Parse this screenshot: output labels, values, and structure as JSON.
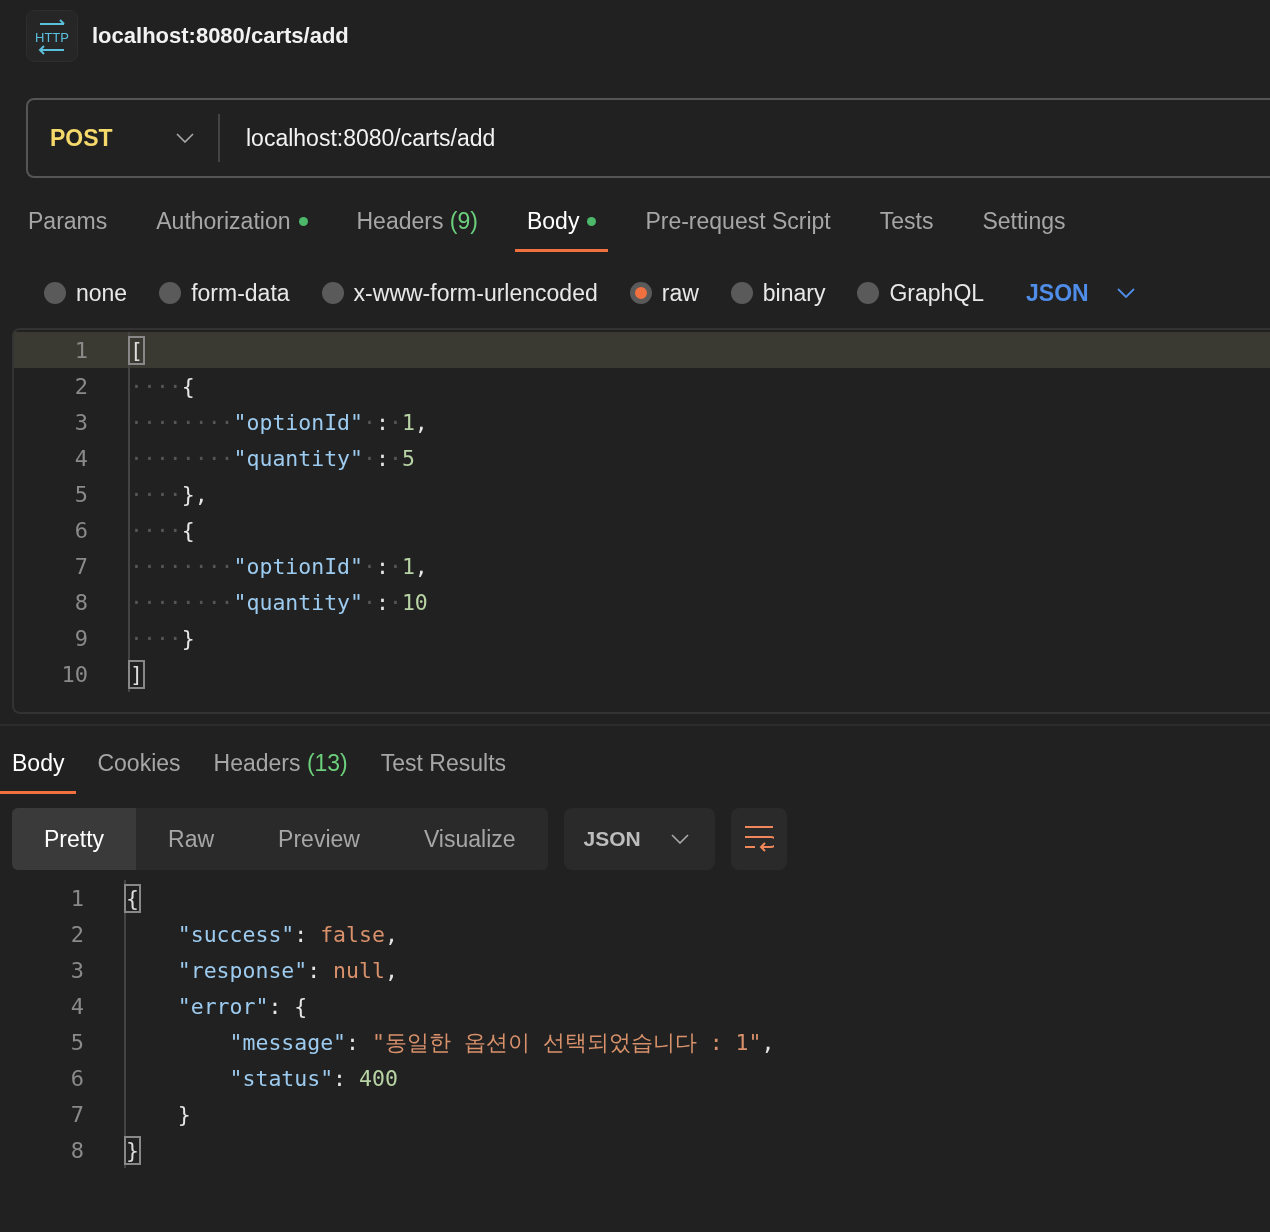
{
  "request": {
    "icon_label": "HTTP",
    "title": "localhost:8080/carts/add",
    "method": "POST",
    "url": "localhost:8080/carts/add"
  },
  "request_tabs": [
    {
      "label": "Params",
      "selected": false,
      "dot": false
    },
    {
      "label": "Authorization",
      "selected": false,
      "dot": true
    },
    {
      "label": "Headers",
      "count": "(9)",
      "selected": false,
      "dot": false
    },
    {
      "label": "Body",
      "selected": true,
      "dot": true
    },
    {
      "label": "Pre-request Script",
      "selected": false,
      "dot": false
    },
    {
      "label": "Tests",
      "selected": false,
      "dot": false
    },
    {
      "label": "Settings",
      "selected": false,
      "dot": false
    }
  ],
  "body_types": [
    {
      "label": "none",
      "selected": false
    },
    {
      "label": "form-data",
      "selected": false
    },
    {
      "label": "x-www-form-urlencoded",
      "selected": false
    },
    {
      "label": "raw",
      "selected": true
    },
    {
      "label": "binary",
      "selected": false
    },
    {
      "label": "GraphQL",
      "selected": false
    }
  ],
  "body_format": "JSON",
  "request_editor": [
    {
      "number": "1",
      "active": true,
      "tokens": [
        {
          "kind": "match",
          "text": "["
        }
      ]
    },
    {
      "number": "2",
      "active": false,
      "tokens": [
        {
          "kind": "ws",
          "text": "····"
        },
        {
          "kind": "punct",
          "text": "{"
        }
      ]
    },
    {
      "number": "3",
      "active": false,
      "tokens": [
        {
          "kind": "ws",
          "text": "········"
        },
        {
          "kind": "key",
          "text": "\"optionId\""
        },
        {
          "kind": "ws",
          "text": "·"
        },
        {
          "kind": "punct",
          "text": ":"
        },
        {
          "kind": "ws",
          "text": "·"
        },
        {
          "kind": "number",
          "text": "1"
        },
        {
          "kind": "punct",
          "text": ","
        }
      ]
    },
    {
      "number": "4",
      "active": false,
      "tokens": [
        {
          "kind": "ws",
          "text": "········"
        },
        {
          "kind": "key",
          "text": "\"quantity\""
        },
        {
          "kind": "ws",
          "text": "·"
        },
        {
          "kind": "punct",
          "text": ":"
        },
        {
          "kind": "ws",
          "text": "·"
        },
        {
          "kind": "number",
          "text": "5"
        }
      ]
    },
    {
      "number": "5",
      "active": false,
      "tokens": [
        {
          "kind": "ws",
          "text": "····"
        },
        {
          "kind": "punct",
          "text": "},"
        }
      ]
    },
    {
      "number": "6",
      "active": false,
      "tokens": [
        {
          "kind": "ws",
          "text": "····"
        },
        {
          "kind": "punct",
          "text": "{"
        }
      ]
    },
    {
      "number": "7",
      "active": false,
      "tokens": [
        {
          "kind": "ws",
          "text": "········"
        },
        {
          "kind": "key",
          "text": "\"optionId\""
        },
        {
          "kind": "ws",
          "text": "·"
        },
        {
          "kind": "punct",
          "text": ":"
        },
        {
          "kind": "ws",
          "text": "·"
        },
        {
          "kind": "number",
          "text": "1"
        },
        {
          "kind": "punct",
          "text": ","
        }
      ]
    },
    {
      "number": "8",
      "active": false,
      "tokens": [
        {
          "kind": "ws",
          "text": "········"
        },
        {
          "kind": "key",
          "text": "\"quantity\""
        },
        {
          "kind": "ws",
          "text": "·"
        },
        {
          "kind": "punct",
          "text": ":"
        },
        {
          "kind": "ws",
          "text": "·"
        },
        {
          "kind": "number",
          "text": "10"
        }
      ]
    },
    {
      "number": "9",
      "active": false,
      "tokens": [
        {
          "kind": "ws",
          "text": "····"
        },
        {
          "kind": "punct",
          "text": "}"
        }
      ]
    },
    {
      "number": "10",
      "active": false,
      "tokens": [
        {
          "kind": "match",
          "text": "]"
        }
      ]
    }
  ],
  "response_tabs": [
    {
      "label": "Body",
      "selected": true
    },
    {
      "label": "Cookies",
      "selected": false
    },
    {
      "label": "Headers",
      "count": "(13)",
      "selected": false
    },
    {
      "label": "Test Results",
      "selected": false
    }
  ],
  "view_modes": [
    {
      "label": "Pretty",
      "selected": true
    },
    {
      "label": "Raw",
      "selected": false
    },
    {
      "label": "Preview",
      "selected": false
    },
    {
      "label": "Visualize",
      "selected": false
    }
  ],
  "response_format": "JSON",
  "response_body": [
    {
      "number": "1",
      "tokens": [
        {
          "kind": "match",
          "text": "{"
        }
      ]
    },
    {
      "number": "2",
      "tokens": [
        {
          "kind": "key",
          "text": "    \"success\""
        },
        {
          "kind": "punct",
          "text": ": "
        },
        {
          "kind": "literal",
          "text": "false"
        },
        {
          "kind": "punct",
          "text": ","
        }
      ]
    },
    {
      "number": "3",
      "tokens": [
        {
          "kind": "key",
          "text": "    \"response\""
        },
        {
          "kind": "punct",
          "text": ": "
        },
        {
          "kind": "literal",
          "text": "null"
        },
        {
          "kind": "punct",
          "text": ","
        }
      ]
    },
    {
      "number": "4",
      "tokens": [
        {
          "kind": "key",
          "text": "    \"error\""
        },
        {
          "kind": "punct",
          "text": ": {"
        }
      ]
    },
    {
      "number": "5",
      "tokens": [
        {
          "kind": "key",
          "text": "        \"message\""
        },
        {
          "kind": "punct",
          "text": ": "
        },
        {
          "kind": "string",
          "text": "\"동일한 옵션이 선택되었습니다 : 1\""
        },
        {
          "kind": "punct",
          "text": ","
        }
      ]
    },
    {
      "number": "6",
      "tokens": [
        {
          "kind": "key",
          "text": "        \"status\""
        },
        {
          "kind": "punct",
          "text": ": "
        },
        {
          "kind": "number",
          "text": "400"
        }
      ]
    },
    {
      "number": "7",
      "tokens": [
        {
          "kind": "punct",
          "text": "    }"
        }
      ]
    },
    {
      "number": "8",
      "tokens": [
        {
          "kind": "match",
          "text": "}"
        }
      ]
    }
  ]
}
